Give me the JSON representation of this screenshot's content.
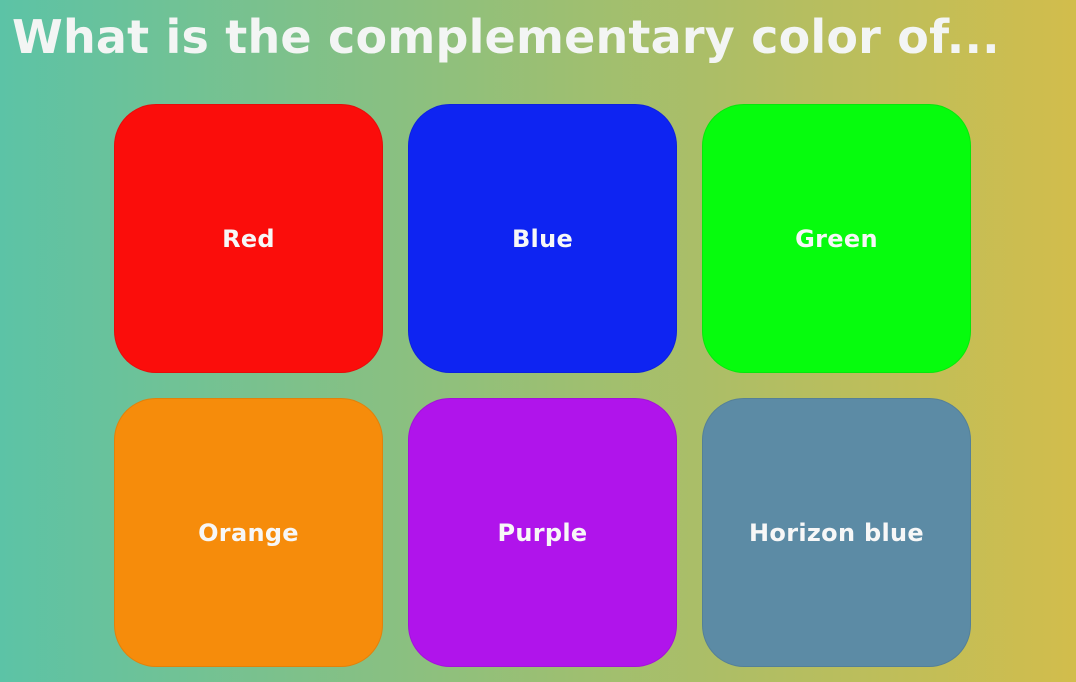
{
  "page": {
    "title": "What is the complementary color of..."
  },
  "tiles": [
    {
      "label": "Red",
      "color": "#fb0d0b"
    },
    {
      "label": "Blue",
      "color": "#0e24f2"
    },
    {
      "label": "Green",
      "color": "#06fc0d"
    },
    {
      "label": "Orange",
      "color": "#f68c0b"
    },
    {
      "label": "Purple",
      "color": "#b014eb"
    },
    {
      "label": "Horizon blue",
      "color": "#5c8ba5"
    }
  ]
}
